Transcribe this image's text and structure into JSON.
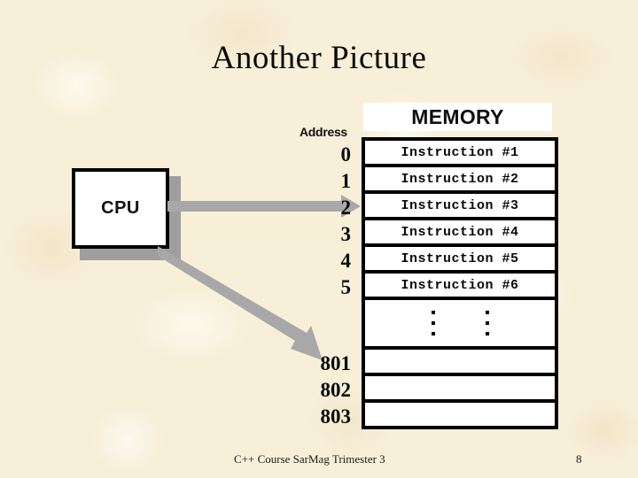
{
  "slide": {
    "title": "Another Picture",
    "background_color": "#f8efd9"
  },
  "cpu": {
    "label": "CPU",
    "box_color": "#ffffff",
    "border_color": "#000000",
    "shadow_color": "#9e9e9e"
  },
  "arrows": {
    "color": "#a8a8a8",
    "horizontal": {
      "name": "cpu-to-address-2-arrow",
      "from": "CPU",
      "to": "2"
    },
    "diagonal": {
      "name": "cpu-to-address-801-arrow",
      "from": "CPU",
      "to": "801"
    }
  },
  "memory": {
    "header": "MEMORY",
    "address_caption": "Address",
    "addresses": [
      "0",
      "1",
      "2",
      "3",
      "4",
      "5",
      "",
      "801",
      "802",
      "803"
    ],
    "rows": [
      {
        "address": "0",
        "content": "Instruction #1",
        "type": "instruction"
      },
      {
        "address": "1",
        "content": "Instruction #2",
        "type": "instruction"
      },
      {
        "address": "2",
        "content": "Instruction #3",
        "type": "instruction"
      },
      {
        "address": "3",
        "content": "Instruction #4",
        "type": "instruction"
      },
      {
        "address": "4",
        "content": "Instruction #5",
        "type": "instruction"
      },
      {
        "address": "5",
        "content": "Instruction #6",
        "type": "instruction"
      },
      {
        "address": "",
        "content": "",
        "type": "ellipsis"
      },
      {
        "address": "801",
        "content": "",
        "type": "empty"
      },
      {
        "address": "802",
        "content": "",
        "type": "empty"
      },
      {
        "address": "803",
        "content": "",
        "type": "empty"
      }
    ]
  },
  "footer": {
    "text": "C++  Course SarMag Trimester 3",
    "page_number": "8"
  }
}
